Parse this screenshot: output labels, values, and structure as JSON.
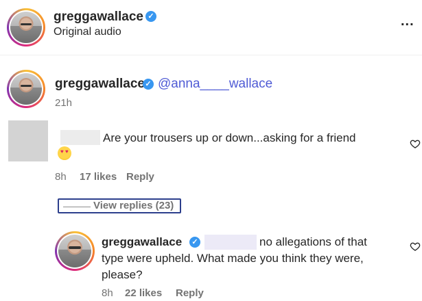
{
  "post": {
    "username": "greggawallace",
    "audio_label": "Original audio",
    "more_label": "..."
  },
  "comment1": {
    "username": "greggawallace",
    "mention": "@anna____wallace",
    "time": "21h"
  },
  "comment2": {
    "text": "Are your trousers up or down...asking for a friend",
    "time": "8h",
    "likes": "17 likes",
    "reply_label": "Reply",
    "view_replies": "View replies (23)"
  },
  "reply": {
    "username": "greggawallace",
    "text_line1": "no allegations of that",
    "text_line2": "type were upheld. What made you think they were,",
    "text_line3": "please?",
    "time": "8h",
    "likes": "22 likes",
    "reply_label": "Reply"
  },
  "icons": {
    "verified": "verified-badge-icon",
    "heart": "heart-outline-icon",
    "emoji": "heart-eyes-emoji-icon"
  },
  "colors": {
    "verified_blue": "#3897f0",
    "mention_purple": "#4f5bd5",
    "meta_gray": "#737373"
  }
}
